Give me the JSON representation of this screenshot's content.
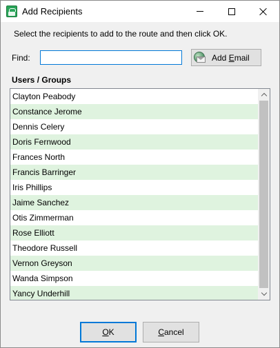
{
  "window": {
    "title": "Add Recipients",
    "icon": "route-icon"
  },
  "instruction": "Select the recipients to add to the route and then click OK.",
  "find": {
    "label": "Find:",
    "value": "",
    "placeholder": ""
  },
  "add_email": {
    "label_prefix": "Add ",
    "label_accel": "E",
    "label_suffix": "mail",
    "icon": "globe-envelope-icon"
  },
  "users_groups": {
    "label": "Users / Groups",
    "items": [
      "Clayton Peabody",
      "Constance Jerome",
      "Dennis Celery",
      "Doris Fernwood",
      "Frances North",
      "Francis Barringer",
      "Iris Phillips",
      "Jaime Sanchez",
      "Otis Zimmerman",
      "Rose Elliott",
      "Theodore Russell",
      "Vernon Greyson",
      "Wanda Simpson",
      "Yancy Underhill"
    ],
    "alt_row_color": "#dff3df"
  },
  "buttons": {
    "ok_accel": "O",
    "ok_rest": "K",
    "cancel_accel": "C",
    "cancel_rest": "ancel"
  },
  "colors": {
    "focus_border": "#0078d7",
    "window_bg": "#f0f0f0"
  }
}
